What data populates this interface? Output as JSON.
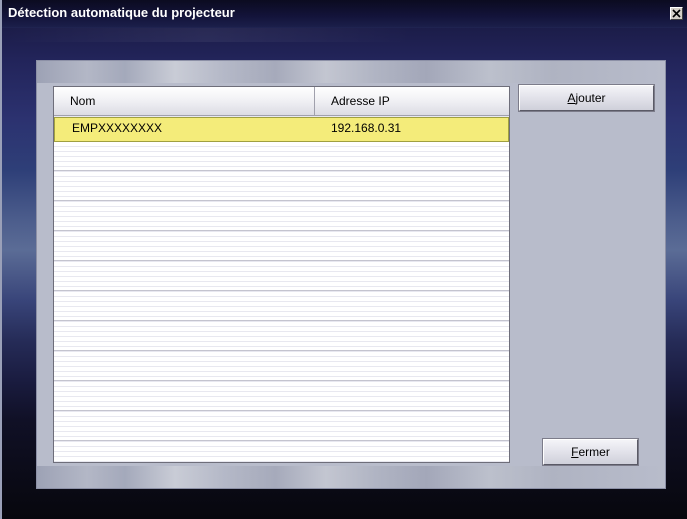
{
  "window": {
    "title": "Détection automatique du projecteur",
    "close_glyph": "✕"
  },
  "list": {
    "columns": {
      "name": "Nom",
      "ip": "Adresse IP"
    },
    "rows": [
      {
        "name": "EMPXXXXXXXX",
        "ip": "192.168.0.31",
        "selected": true
      }
    ]
  },
  "buttons": {
    "add": {
      "mnemonic": "A",
      "rest": "jouter"
    },
    "close": {
      "mnemonic": "F",
      "rest": "ermer"
    }
  },
  "colors": {
    "selected_row": "#f4ec7a",
    "panel": "#b8bccb",
    "title_bar": "#13133a"
  }
}
